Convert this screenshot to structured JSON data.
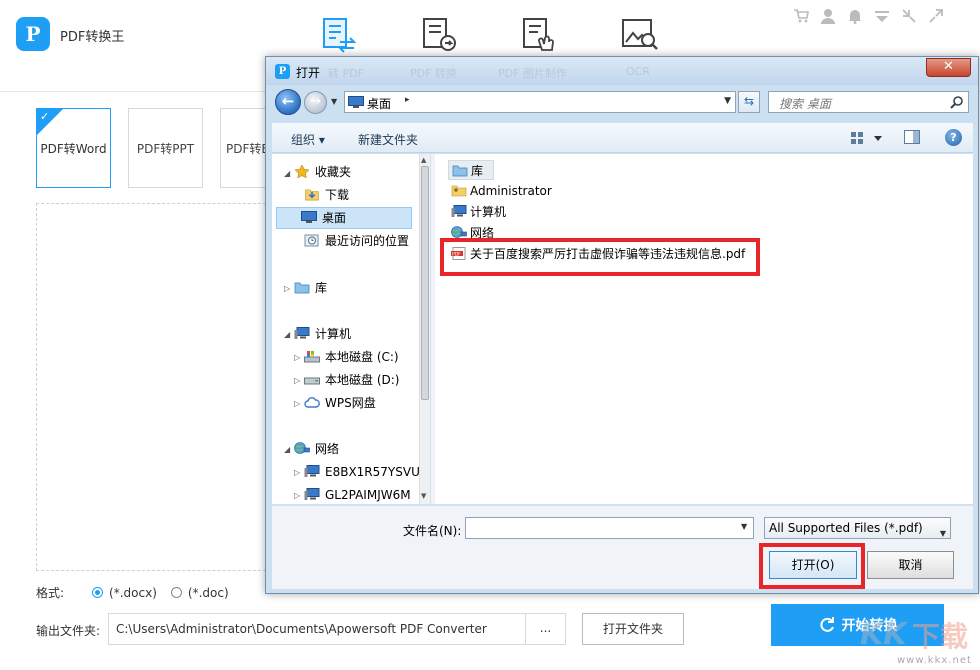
{
  "app": {
    "title": "PDF转换王",
    "logo_letter": "P",
    "brand_color": "#1e9ef4",
    "tools": [
      {
        "icon": "pdf-convert-tool-icon"
      },
      {
        "icon": "pdf-export-tool-icon"
      },
      {
        "icon": "pdf-edit-tool-icon"
      },
      {
        "icon": "image-ocr-tool-icon"
      }
    ],
    "top_icons": [
      "cart-icon",
      "user-icon",
      "bell-icon",
      "menu-icon",
      "minimize-icon",
      "maximize-icon"
    ]
  },
  "conversion": {
    "cards": [
      {
        "label": "PDF转Word",
        "selected": true
      },
      {
        "label": "PDF转PPT",
        "selected": false
      },
      {
        "label": "PDF转E",
        "selected": false
      }
    ],
    "check_mark": "✓"
  },
  "format": {
    "label": "格式:",
    "options": [
      {
        "label": "(*.docx)",
        "selected": true
      },
      {
        "label": "(*.doc)",
        "selected": false
      }
    ]
  },
  "output": {
    "label": "输出文件夹:",
    "path": "C:\\Users\\Administrator\\Documents\\Apowersoft PDF Converter",
    "browse_label": "...",
    "open_folder_label": "打开文件夹"
  },
  "start_button": {
    "label": "开始转换"
  },
  "watermark": {
    "url": "www.kkx.net"
  },
  "dialog": {
    "title": "打开",
    "ghost_tabs": [
      "转 PDF",
      "PDF 转换",
      "PDF 图片制作",
      "OCR"
    ],
    "close_label": "✕",
    "address": {
      "location": "桌面",
      "separator": "▸"
    },
    "search_placeholder": "搜索 桌面",
    "toolbar": {
      "organize": "组织 ▾",
      "new_folder": "新建文件夹",
      "help": "?"
    },
    "nav_items": [
      {
        "label": "收藏夹",
        "icon": "star-icon"
      },
      {
        "label": "下载",
        "icon": "download-folder-icon"
      },
      {
        "label": "桌面",
        "icon": "desktop-icon",
        "selected": true
      },
      {
        "label": "最近访问的位置",
        "icon": "recent-places-icon"
      },
      {
        "label": "库",
        "icon": "library-icon"
      },
      {
        "label": "计算机",
        "icon": "computer-icon"
      },
      {
        "label": "本地磁盘 (C:)",
        "icon": "system-drive-icon"
      },
      {
        "label": "本地磁盘 (D:)",
        "icon": "drive-icon"
      },
      {
        "label": "WPS网盘",
        "icon": "cloud-drive-icon"
      },
      {
        "label": "网络",
        "icon": "network-icon"
      },
      {
        "label": "E8BX1R57YSVU",
        "icon": "network-computer-icon"
      },
      {
        "label": "GL2PAIMJW6M",
        "icon": "network-computer-icon"
      }
    ],
    "files": [
      {
        "label": "库",
        "icon": "library-icon"
      },
      {
        "label": "Administrator",
        "icon": "user-folder-icon"
      },
      {
        "label": "计算机",
        "icon": "computer-icon"
      },
      {
        "label": "网络",
        "icon": "network-icon"
      },
      {
        "label": "关于百度搜索严厉打击虚假诈骗等违法违规信息.pdf",
        "icon": "pdf-file-icon"
      }
    ],
    "filename_label": "文件名(N):",
    "filename_value": "",
    "filetype": "All Supported Files (*.pdf)",
    "open_label": "打开(O)",
    "cancel_label": "取消",
    "highlight_color": "#e8262a"
  }
}
